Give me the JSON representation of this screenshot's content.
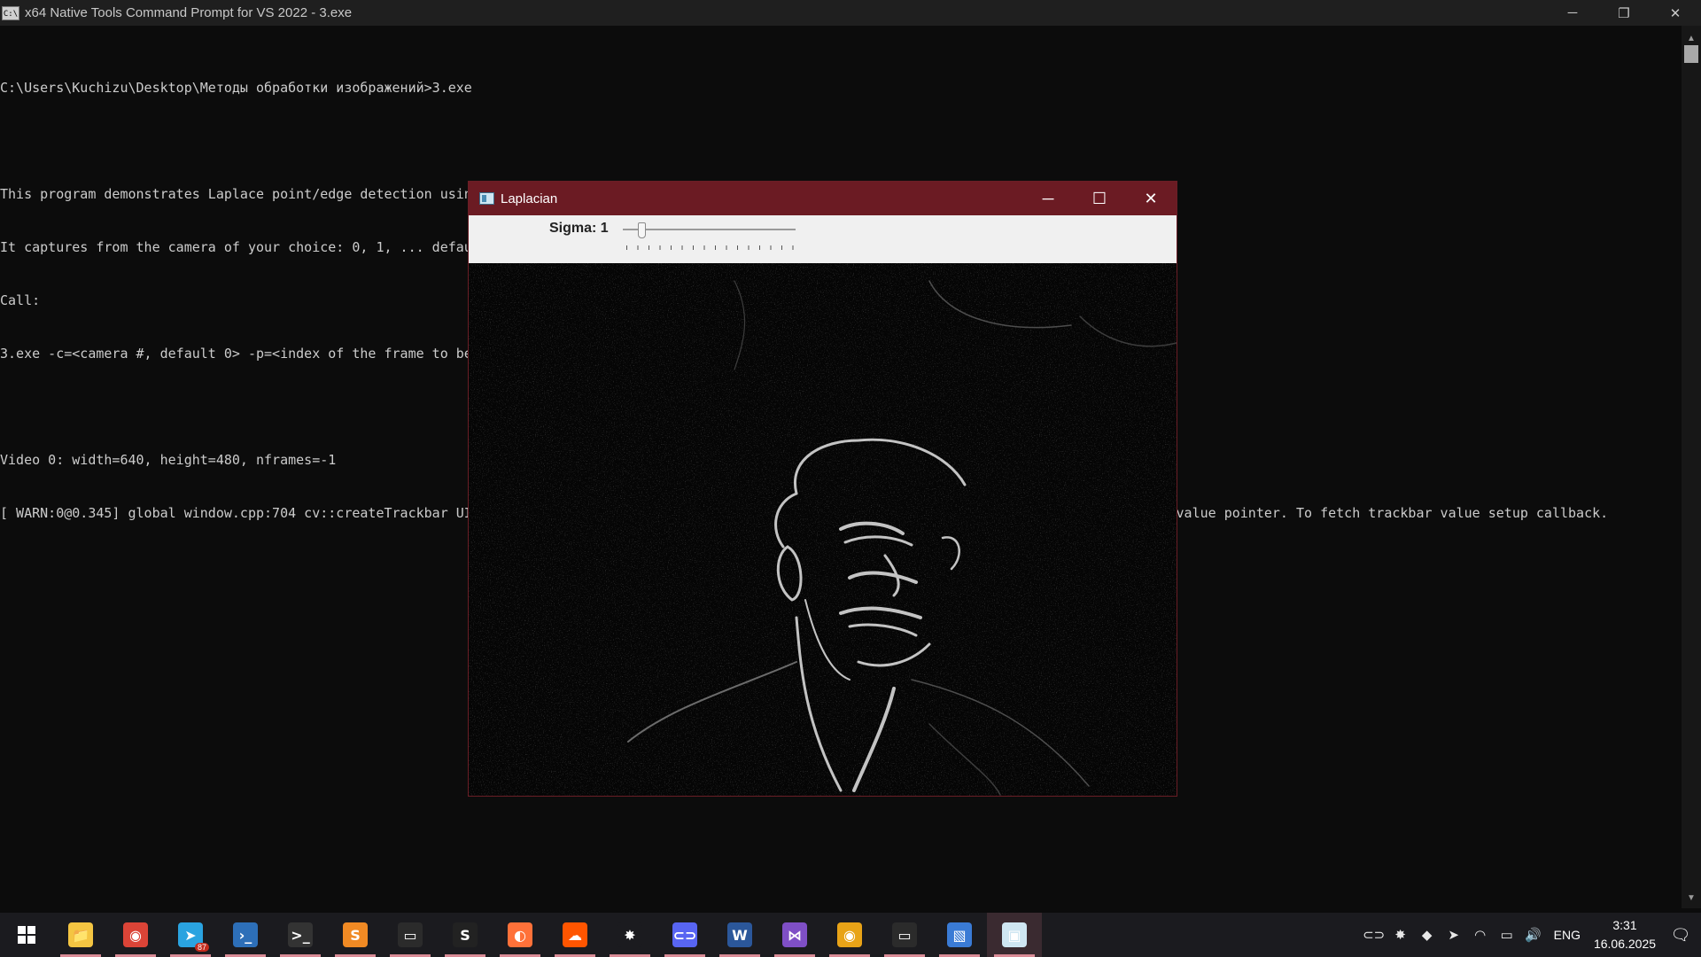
{
  "console": {
    "title": "x64 Native Tools Command Prompt for VS 2022 - 3.exe",
    "icon_text": "C:\\",
    "lines": [
      "C:\\Users\\Kuchizu\\Desktop\\Методы обработки изображений>3.exe",
      "",
      "This program demonstrates Laplace point/edge detection using OpenCV function Laplacian()",
      "It captures from the camera of your choice: 0, 1, ... default 0",
      "Call:",
      "3.exe -c=<camera #, default 0> -p=<index of the frame to be decoded/captured next>",
      "",
      "Video 0: width=640, height=480, nframes=-1",
      "[ WARN:0@0.345] global window.cpp:704 cv::createTrackbar UI/Trackbar(Sigma@Laplacian): Using 'value' pointer is unsafe and deprecated. Use NULL as value pointer. To fetch trackbar value setup callback."
    ]
  },
  "window_controls": {
    "minimize": "─",
    "maximize": "☐",
    "restore": "❐",
    "close": "✕"
  },
  "cv_window": {
    "title": "Laplacian",
    "trackbar_label": "Sigma: 1",
    "trackbar_value": 1
  },
  "taskbar": {
    "apps": [
      {
        "name": "file-explorer",
        "glyph": "📁",
        "color": "#f4c542",
        "active": false,
        "badge": ""
      },
      {
        "name": "chrome",
        "glyph": "◉",
        "color": "#db4437",
        "active": false,
        "badge": ""
      },
      {
        "name": "telegram",
        "glyph": "➤",
        "color": "#2aa3e0",
        "active": false,
        "badge": "87"
      },
      {
        "name": "powershell",
        "glyph": "›_",
        "color": "#2d6fb8",
        "active": false,
        "badge": ""
      },
      {
        "name": "terminal",
        "glyph": ">_",
        "color": "#333333",
        "active": false,
        "badge": ""
      },
      {
        "name": "sublime-text",
        "glyph": "S",
        "color": "#f08a24",
        "active": false,
        "badge": ""
      },
      {
        "name": "console-window",
        "glyph": "▭",
        "color": "#2b2b2b",
        "active": false,
        "badge": ""
      },
      {
        "name": "app-s",
        "glyph": "S",
        "color": "#222222",
        "active": false,
        "badge": ""
      },
      {
        "name": "firefox",
        "glyph": "◐",
        "color": "#ff7139",
        "active": false,
        "badge": ""
      },
      {
        "name": "soundcloud",
        "glyph": "☁",
        "color": "#ff5500",
        "active": false,
        "badge": ""
      },
      {
        "name": "sun-app",
        "glyph": "✸",
        "color": "#1b1b1f",
        "active": false,
        "badge": ""
      },
      {
        "name": "link-app",
        "glyph": "⊂⊃",
        "color": "#5865f2",
        "active": false,
        "badge": ""
      },
      {
        "name": "word",
        "glyph": "W",
        "color": "#2b579a",
        "active": false,
        "badge": ""
      },
      {
        "name": "visual-studio",
        "glyph": "⋈",
        "color": "#7f4fc6",
        "active": false,
        "badge": ""
      },
      {
        "name": "chrome-canary",
        "glyph": "◉",
        "color": "#e8a317",
        "active": false,
        "badge": ""
      },
      {
        "name": "command-prompt",
        "glyph": "▭",
        "color": "#2b2b2b",
        "active": false,
        "badge": ""
      },
      {
        "name": "photos",
        "glyph": "▧",
        "color": "#3a7bd5",
        "active": false,
        "badge": ""
      },
      {
        "name": "opencv-window",
        "glyph": "▣",
        "color": "#cfe6f2",
        "active": true,
        "badge": ""
      }
    ],
    "tray": {
      "icons": [
        "link-tray",
        "sun-tray",
        "nvidia",
        "telegram-tray",
        "wifi",
        "battery",
        "volume"
      ],
      "glyphs": [
        "⊂⊃",
        "✸",
        "◆",
        "➤",
        "◠",
        "▭",
        "🔊"
      ],
      "language": "ENG",
      "time": "3:31",
      "date": "16.06.2025",
      "notification_glyph": "🗨"
    }
  }
}
